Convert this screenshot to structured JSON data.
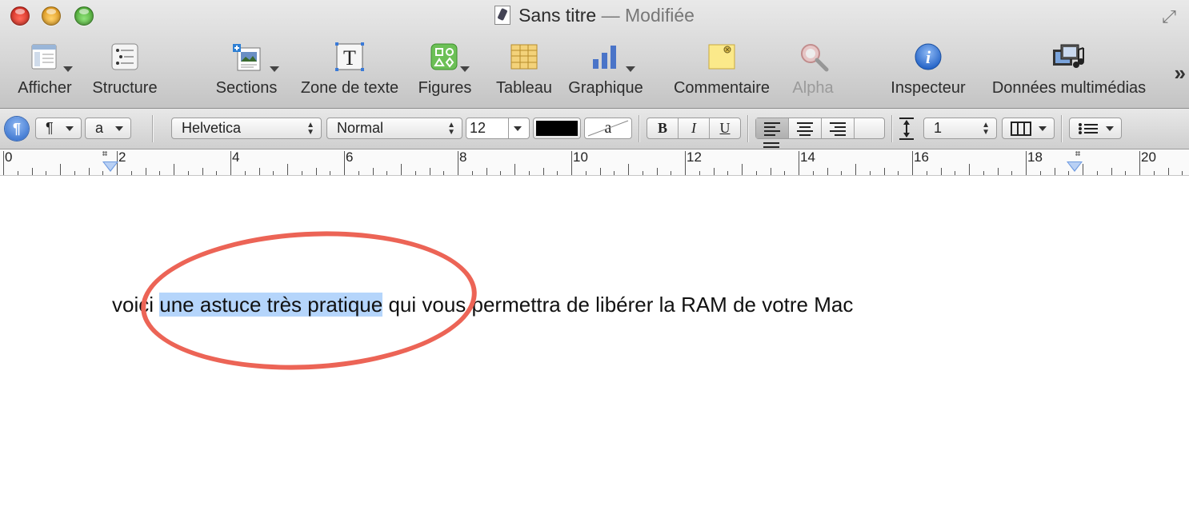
{
  "window": {
    "title": "Sans titre",
    "title_separator": "—",
    "title_status": "Modifiée"
  },
  "toolbar": {
    "items": [
      {
        "label": "Afficher",
        "icon": "view-icon",
        "has_menu": true
      },
      {
        "label": "Structure",
        "icon": "outline-icon",
        "has_menu": false
      },
      {
        "label": "Sections",
        "icon": "sections-icon",
        "has_menu": true
      },
      {
        "label": "Zone de texte",
        "icon": "text-box-icon",
        "has_menu": false
      },
      {
        "label": "Figures",
        "icon": "shapes-icon",
        "has_menu": true
      },
      {
        "label": "Tableau",
        "icon": "table-icon",
        "has_menu": false
      },
      {
        "label": "Graphique",
        "icon": "chart-icon",
        "has_menu": true
      },
      {
        "label": "Commentaire",
        "icon": "comment-icon",
        "has_menu": false
      },
      {
        "label": "Alpha",
        "icon": "alpha-icon",
        "has_menu": false,
        "disabled": true
      },
      {
        "label": "Inspecteur",
        "icon": "info-icon",
        "has_menu": false
      },
      {
        "label": "Données multimédias",
        "icon": "media-icon",
        "has_menu": false
      }
    ],
    "overflow": "»"
  },
  "formatbar": {
    "paragraph_styles_symbol": "¶",
    "paragraph_style": "¶",
    "character_style": "a",
    "font_family": "Helvetica",
    "font_typeface": "Normal",
    "font_size": "12",
    "text_color": "#000000",
    "highlight_label": "a",
    "bold": "B",
    "italic": "I",
    "underline": "U",
    "line_spacing": "1"
  },
  "ruler": {
    "labels": [
      "0",
      "2",
      "4",
      "6",
      "8",
      "10",
      "12",
      "14",
      "16",
      "18",
      "20"
    ]
  },
  "document": {
    "text_before": "voici ",
    "text_selected": "une astuce très pratique",
    "text_after": " qui vous permettra de libérer la RAM de votre Mac"
  },
  "colors": {
    "selection": "#b5d5fb",
    "annotation_circle": "#ec6456",
    "ruler_marker": "#6f9be0"
  }
}
